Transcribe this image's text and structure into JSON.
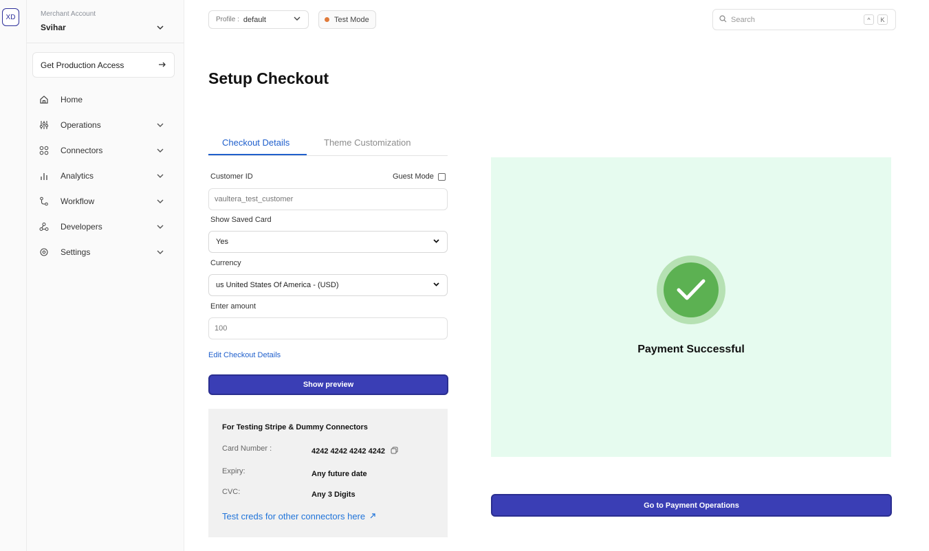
{
  "rail": {
    "avatar_initials": "XD"
  },
  "sidebar": {
    "merchant_label": "Merchant Account",
    "merchant_name": "Svihar",
    "prod_access_label": "Get Production Access",
    "items": [
      {
        "label": "Home",
        "icon": "home-icon",
        "expandable": false
      },
      {
        "label": "Operations",
        "icon": "sliders-icon",
        "expandable": true
      },
      {
        "label": "Connectors",
        "icon": "grid-icon",
        "expandable": true
      },
      {
        "label": "Analytics",
        "icon": "bar-chart-icon",
        "expandable": true
      },
      {
        "label": "Workflow",
        "icon": "workflow-icon",
        "expandable": true
      },
      {
        "label": "Developers",
        "icon": "webhook-icon",
        "expandable": true
      },
      {
        "label": "Settings",
        "icon": "gear-icon",
        "expandable": true
      }
    ]
  },
  "topbar": {
    "profile_label": "Profile :",
    "profile_value": "default",
    "test_mode_label": "Test Mode",
    "search_placeholder": "Search",
    "shortcut_keys": [
      "^",
      "K"
    ]
  },
  "page": {
    "title": "Setup Checkout",
    "tabs": [
      "Checkout Details",
      "Theme Customization"
    ],
    "active_tab": "Checkout Details"
  },
  "form": {
    "customer_id_label": "Customer ID",
    "guest_mode_label": "Guest Mode",
    "guest_mode_checked": false,
    "customer_id_value": "vaultera_test_customer",
    "show_saved_card_label": "Show Saved Card",
    "show_saved_card_value": "Yes",
    "currency_label": "Currency",
    "currency_value": "us United States Of America - (USD)",
    "amount_label": "Enter amount",
    "amount_value": "100",
    "edit_link": "Edit Checkout Details",
    "preview_button": "Show preview"
  },
  "test_info": {
    "title": "For Testing Stripe & Dummy Connectors",
    "card_number_label": "Card Number :",
    "card_number_value": "4242 4242 4242 4242",
    "expiry_label": "Expiry:",
    "expiry_value": "Any future date",
    "cvc_label": "CVC:",
    "cvc_value": "Any 3 Digits",
    "other_creds_link": "Test creds for other connectors here"
  },
  "preview": {
    "status_text": "Payment Successful",
    "panel_color": "#e6fbef",
    "success_color": "#5cb152"
  },
  "actions": {
    "goto_operations": "Go to Payment Operations"
  },
  "colors": {
    "accent": "#3a3eb5",
    "link": "#1f5fcc",
    "test_mode_dot": "#e07a3a"
  }
}
